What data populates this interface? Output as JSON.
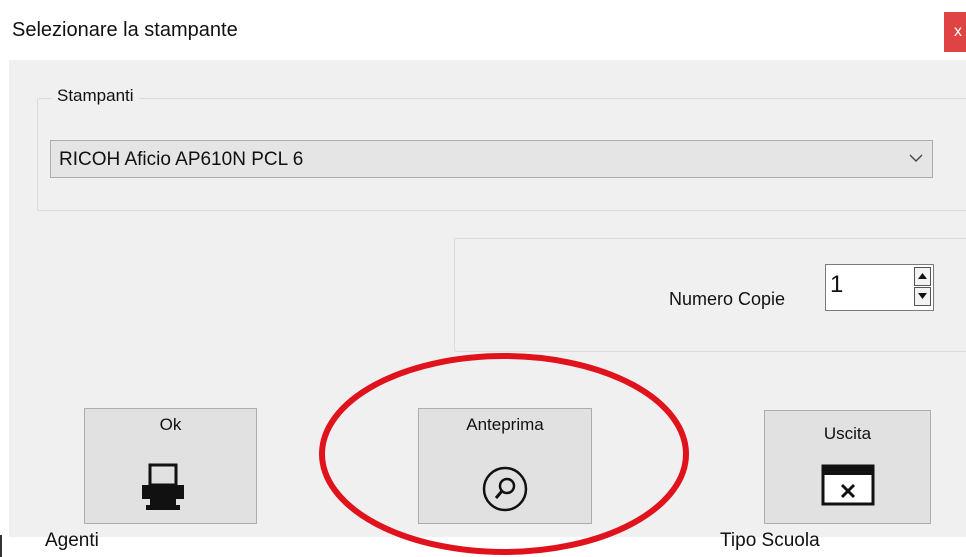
{
  "dialog": {
    "title": "Selezionare la stampante",
    "close_glyph": "x"
  },
  "printers_group": {
    "legend": "Stampanti",
    "selected_printer": "RICOH Aficio AP610N PCL 6"
  },
  "copies_group": {
    "label": "Numero Copie",
    "value": "1"
  },
  "buttons": {
    "ok_label": "Ok",
    "preview_label": "Anteprima",
    "exit_label": "Uscita"
  },
  "background_window": {
    "left_text": "Agenti",
    "right_text": "Tipo Scuola"
  },
  "icons": {
    "ok": "printer-icon",
    "preview": "magnifier-icon",
    "exit": "window-close-icon",
    "combo": "chevron-down-icon"
  },
  "colors": {
    "close_button": "#e04343",
    "dialog_background": "#f0f0f0",
    "annotation_circle": "#e0121c"
  }
}
